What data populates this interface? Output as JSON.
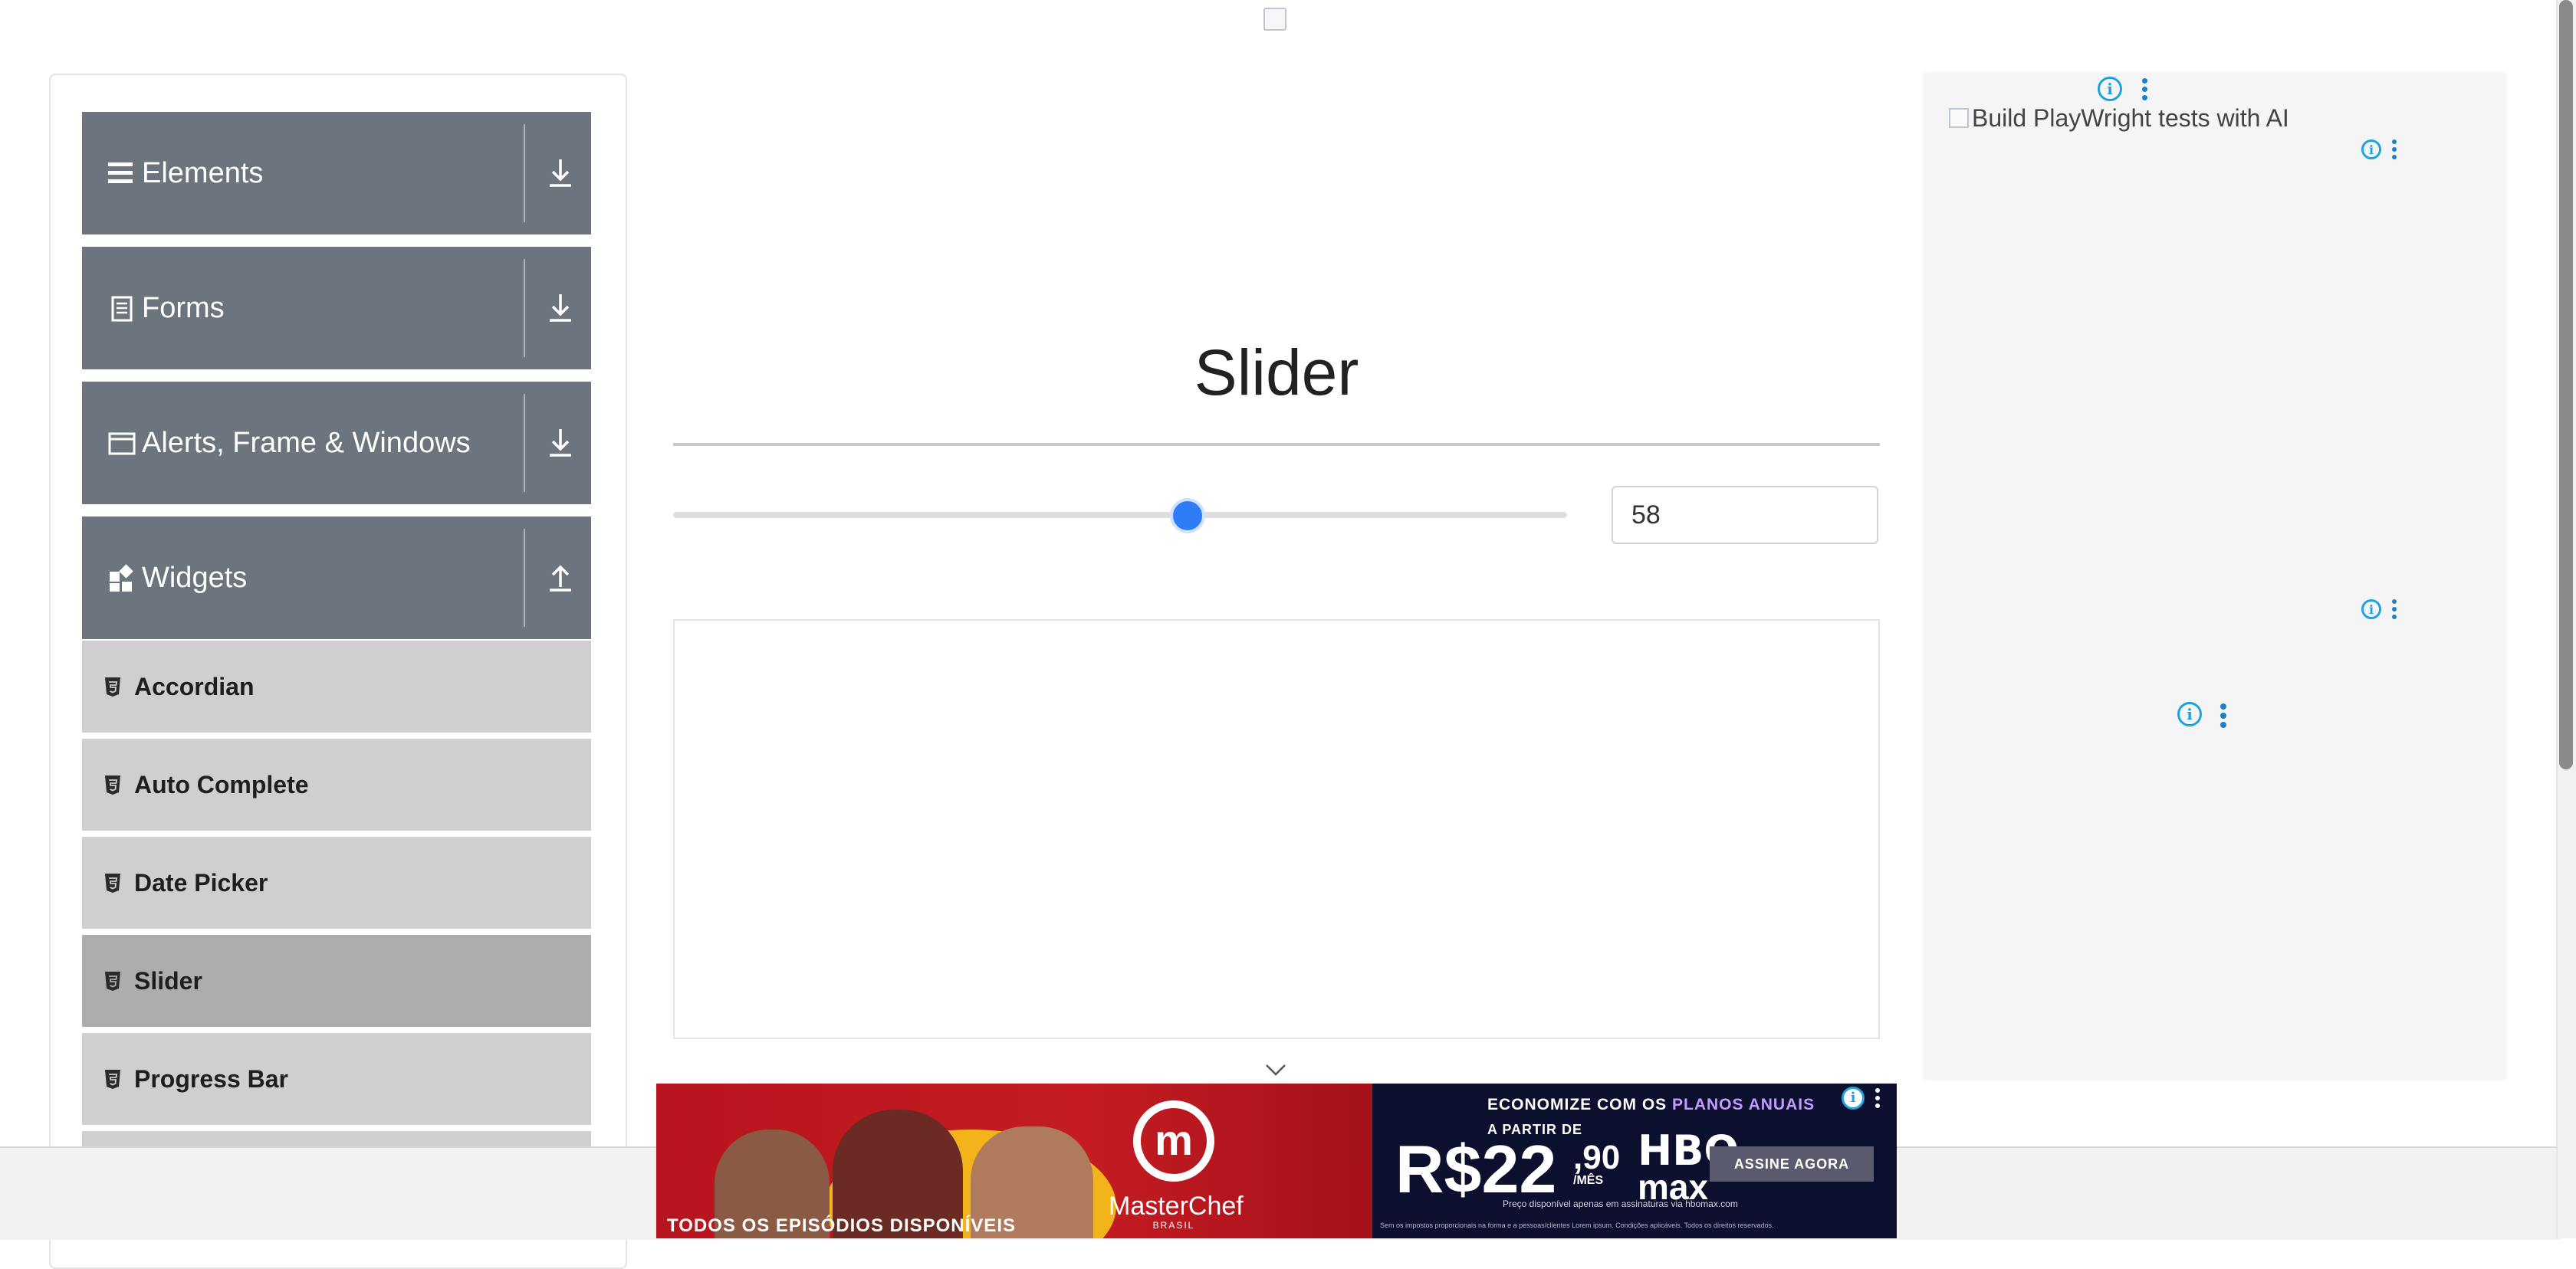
{
  "banner": {
    "icon": "broken-image-icon"
  },
  "sidebar": {
    "groups": [
      {
        "label": "Elements",
        "icon": "hamburger-icon",
        "arrow": "download-arrow-icon"
      },
      {
        "label": "Forms",
        "icon": "document-icon",
        "arrow": "download-arrow-icon"
      },
      {
        "label": "Alerts, Frame & Windows",
        "icon": "window-icon",
        "arrow": "download-arrow-icon"
      },
      {
        "label": "Widgets",
        "icon": "widgets-icon",
        "arrow": "upload-arrow-icon",
        "expanded": true
      }
    ],
    "items": [
      {
        "label": "Accordian",
        "icon": "html5-icon",
        "active": false
      },
      {
        "label": "Auto Complete",
        "icon": "html5-icon",
        "active": false
      },
      {
        "label": "Date Picker",
        "icon": "html5-icon",
        "active": false
      },
      {
        "label": "Slider",
        "icon": "html5-icon",
        "active": true
      },
      {
        "label": "Progress Bar",
        "icon": "html5-icon",
        "active": false
      }
    ]
  },
  "main": {
    "title": "Slider",
    "slider": {
      "value": "58",
      "min": 0,
      "max": 100,
      "accent": "#2f7df6"
    }
  },
  "ads": {
    "sidebar_alt_text": "Build PlayWright tests with AI",
    "choices_icons": [
      "info-icon",
      "more-vertical-icon"
    ],
    "bottom": {
      "episodes": "TODOS OS EPISÓDIOS DISPONÍVEIS",
      "brand": "MasterChef",
      "brand_sub": "BRASIL",
      "save_a": "ECONOMIZE COM OS ",
      "save_b": "PLANOS ANUAIS",
      "from": "A PARTIR DE",
      "price": "R$22",
      "cents": ",90",
      "per_month": "/MÊS",
      "hbo": "HBO",
      "max": "max",
      "cta": "ASSINE AGORA",
      "fine1": "Preço disponível apenas em assinaturas via hbomax.com",
      "fine2": "Sem os impostos proporcionais na forma e a pessoas/clientes Lorem ipsum. Condições aplicáveis. Todos os direitos reservados."
    }
  },
  "colors": {
    "group_bg": "#6c757d",
    "item_bg": "#cfcfcf",
    "item_active_bg": "#adadad",
    "adchoice_blue": "#1fa3e0"
  }
}
